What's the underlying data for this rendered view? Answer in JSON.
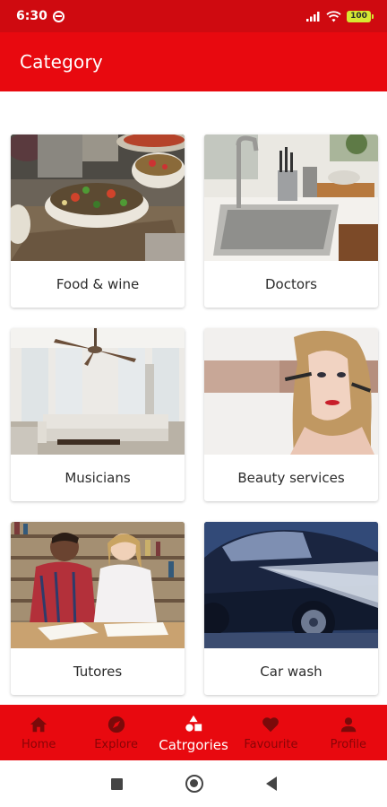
{
  "status_bar": {
    "time": "6:30",
    "battery": "100"
  },
  "app_bar": {
    "title": "Category"
  },
  "categories": [
    {
      "label": "Food & wine",
      "image": "food-salad-photo"
    },
    {
      "label": "Doctors",
      "image": "kitchen-sink-photo"
    },
    {
      "label": "Musicians",
      "image": "living-room-photo"
    },
    {
      "label": "Beauty services",
      "image": "makeup-woman-photo"
    },
    {
      "label": "Tutores",
      "image": "students-studying-photo"
    },
    {
      "label": "Car wash",
      "image": "car-wash-photo"
    }
  ],
  "bottom_nav": {
    "items": [
      {
        "label": "Home",
        "icon": "home-icon",
        "active": false
      },
      {
        "label": "Explore",
        "icon": "compass-icon",
        "active": false
      },
      {
        "label": "Catrgories",
        "icon": "categories-icon",
        "active": true
      },
      {
        "label": "Favourite",
        "icon": "heart-icon",
        "active": false
      },
      {
        "label": "Profile",
        "icon": "person-icon",
        "active": false
      }
    ]
  },
  "colors": {
    "primary": "#e8090f",
    "status_bar": "#cf0a10",
    "nav_inactive": "#7a0a0a",
    "nav_active": "#ffffff"
  }
}
